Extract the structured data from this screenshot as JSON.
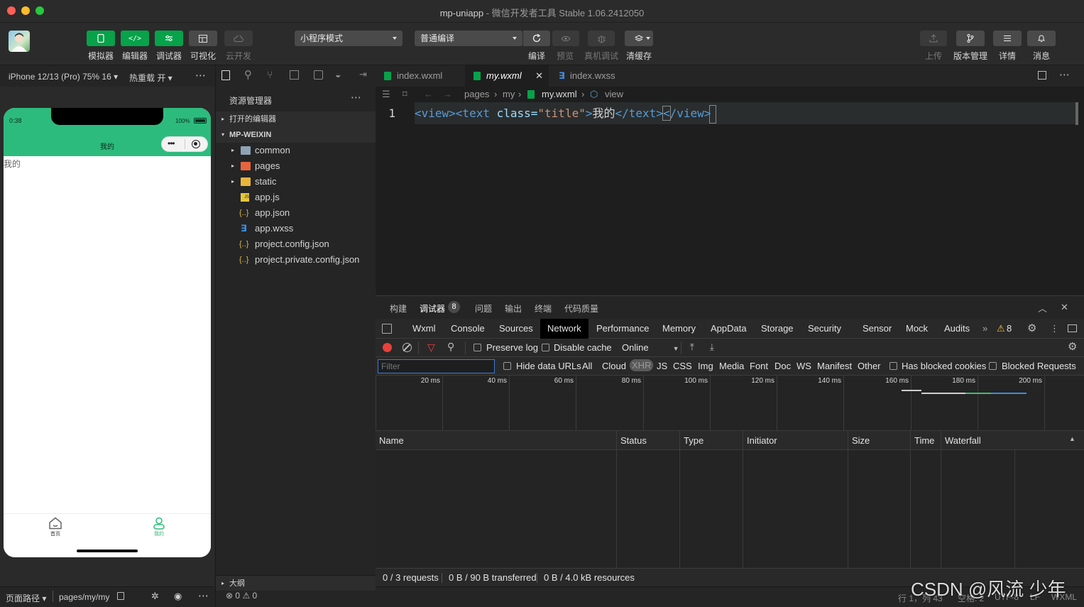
{
  "window": {
    "title_app": "mp-uniapp",
    "title_rest": " - 微信开发者工具 Stable 1.06.2412050"
  },
  "toolbar": {
    "simulator": "模拟器",
    "editor": "编辑器",
    "debugger": "调试器",
    "visual": "可视化",
    "cloud": "云开发",
    "mode_select": "小程序模式",
    "compile_select": "普通编译",
    "compile": "编译",
    "preview": "预览",
    "real_debug": "真机调试",
    "clear_cache": "清缓存",
    "upload": "上传",
    "version": "版本管理",
    "details": "详情",
    "messages": "消息"
  },
  "simulator": {
    "device": "iPhone 12/13 (Pro) 75% 16",
    "hot_reload": "热重载 开",
    "time": "0:38",
    "battery": "100%",
    "nav_title": "我的",
    "page_text": "我的",
    "tab_home": "首页",
    "tab_mine": "我的",
    "footer_path_label": "页面路径",
    "footer_path": "pages/my/my"
  },
  "explorer": {
    "title": "资源管理器",
    "open_editors": "打开的编辑器",
    "project": "MP-WEIXIN",
    "items": [
      {
        "name": "common",
        "type": "folder"
      },
      {
        "name": "pages",
        "type": "folder-red"
      },
      {
        "name": "static",
        "type": "folder-yellow"
      },
      {
        "name": "app.js",
        "type": "js"
      },
      {
        "name": "app.json",
        "type": "json"
      },
      {
        "name": "app.wxss",
        "type": "css"
      },
      {
        "name": "project.config.json",
        "type": "json"
      },
      {
        "name": "project.private.config.json",
        "type": "json"
      }
    ],
    "outline": "大纲",
    "problems": "0",
    "warnings": "0"
  },
  "editor": {
    "tabs": [
      "index.wxml",
      "my.wxml",
      "index.wxss"
    ],
    "breadcrumb": [
      "pages",
      "my",
      "my.wxml",
      "view"
    ],
    "line_number": "1",
    "code": {
      "open_view": "<view>",
      "open_text": "<text",
      "attr": " class=",
      "attr_value": "\"title\"",
      "gt": ">",
      "content": "我的",
      "close_text": "</text>",
      "close_view_lt": "<",
      "close_view": "/view>"
    }
  },
  "devtools": {
    "panels": [
      "构建",
      "调试器",
      "问题",
      "输出",
      "终端",
      "代码质量"
    ],
    "debugger_badge": "8",
    "tabs": [
      "Wxml",
      "Console",
      "Sources",
      "Network",
      "Performance",
      "Memory",
      "AppData",
      "Storage",
      "Security",
      "Sensor",
      "Mock",
      "Audits"
    ],
    "active_tab": "Network",
    "warnings_count": "8",
    "preserve_log": "Preserve log",
    "disable_cache": "Disable cache",
    "throttle": "Online",
    "filter_placeholder": "Filter",
    "hide_data_urls": "Hide data URLs",
    "filter_types": [
      "All",
      "Cloud",
      "XHR",
      "JS",
      "CSS",
      "Img",
      "Media",
      "Font",
      "Doc",
      "WS",
      "Manifest",
      "Other"
    ],
    "has_blocked_cookies": "Has blocked cookies",
    "blocked_requests": "Blocked Requests",
    "ticks": [
      "20 ms",
      "40 ms",
      "60 ms",
      "80 ms",
      "100 ms",
      "120 ms",
      "140 ms",
      "160 ms",
      "180 ms",
      "200 ms"
    ],
    "columns": [
      "Name",
      "Status",
      "Type",
      "Initiator",
      "Size",
      "Time",
      "Waterfall"
    ],
    "status_requests": "0 / 3 requests",
    "status_transferred": "0 B / 90 B transferred",
    "status_resources": "0 B / 4.0 kB resources"
  },
  "statusbar": {
    "position": "行 1，列 43",
    "spaces": "空格: 2",
    "encoding": "UTF-8",
    "eol": "LF",
    "language": "WXML"
  },
  "watermark": "CSDN @风流 少年",
  "colors": {
    "accent_green": "#07a24a",
    "nav_green": "#2dbb7d",
    "tag_blue": "#569cd6",
    "attr_blue": "#9cdcfe",
    "string_orange": "#ce9178",
    "record_red": "#e8413c"
  }
}
